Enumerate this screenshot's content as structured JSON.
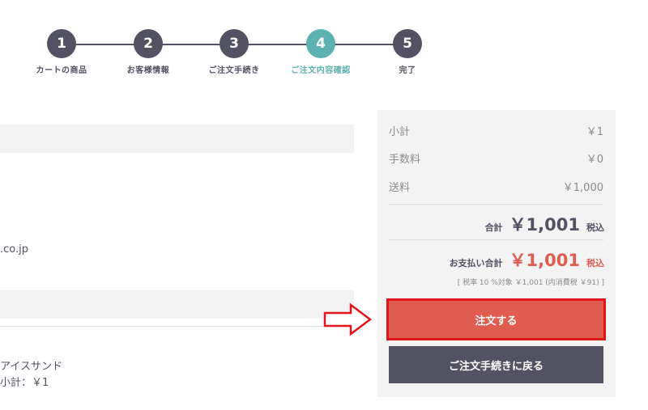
{
  "stepper": {
    "steps": [
      {
        "num": "1",
        "label": "カートの商品"
      },
      {
        "num": "2",
        "label": "お客様情報"
      },
      {
        "num": "3",
        "label": "ご注文手続き"
      },
      {
        "num": "4",
        "label": "ご注文内容確認"
      },
      {
        "num": "5",
        "label": "完了"
      }
    ],
    "active_step": 4
  },
  "left": {
    "email_fragment": ".co.jp",
    "product_fragment": "アイスサンド",
    "subtotal_fragment": "小計：￥1"
  },
  "summary": {
    "subtotal_label": "小計",
    "subtotal_value": "￥1",
    "fee_label": "手数料",
    "fee_value": "￥0",
    "shipping_label": "送料",
    "shipping_value": "￥1,000",
    "total_label": "合計",
    "total_value": "￥1,001",
    "total_tax": "税込",
    "payment_label": "お支払い合計",
    "payment_value": "￥1,001",
    "payment_tax": "税込",
    "tax_note": "[ 税率 10 %対象 ￥1,001 (内消費税 ￥91) ]"
  },
  "buttons": {
    "order": "注文する",
    "back": "ご注文手続きに戻る"
  },
  "colors": {
    "dark": "#525263",
    "teal_active": "#5cb1b1",
    "accent_red": "#de5d50",
    "highlight_border": "#e0161d"
  }
}
